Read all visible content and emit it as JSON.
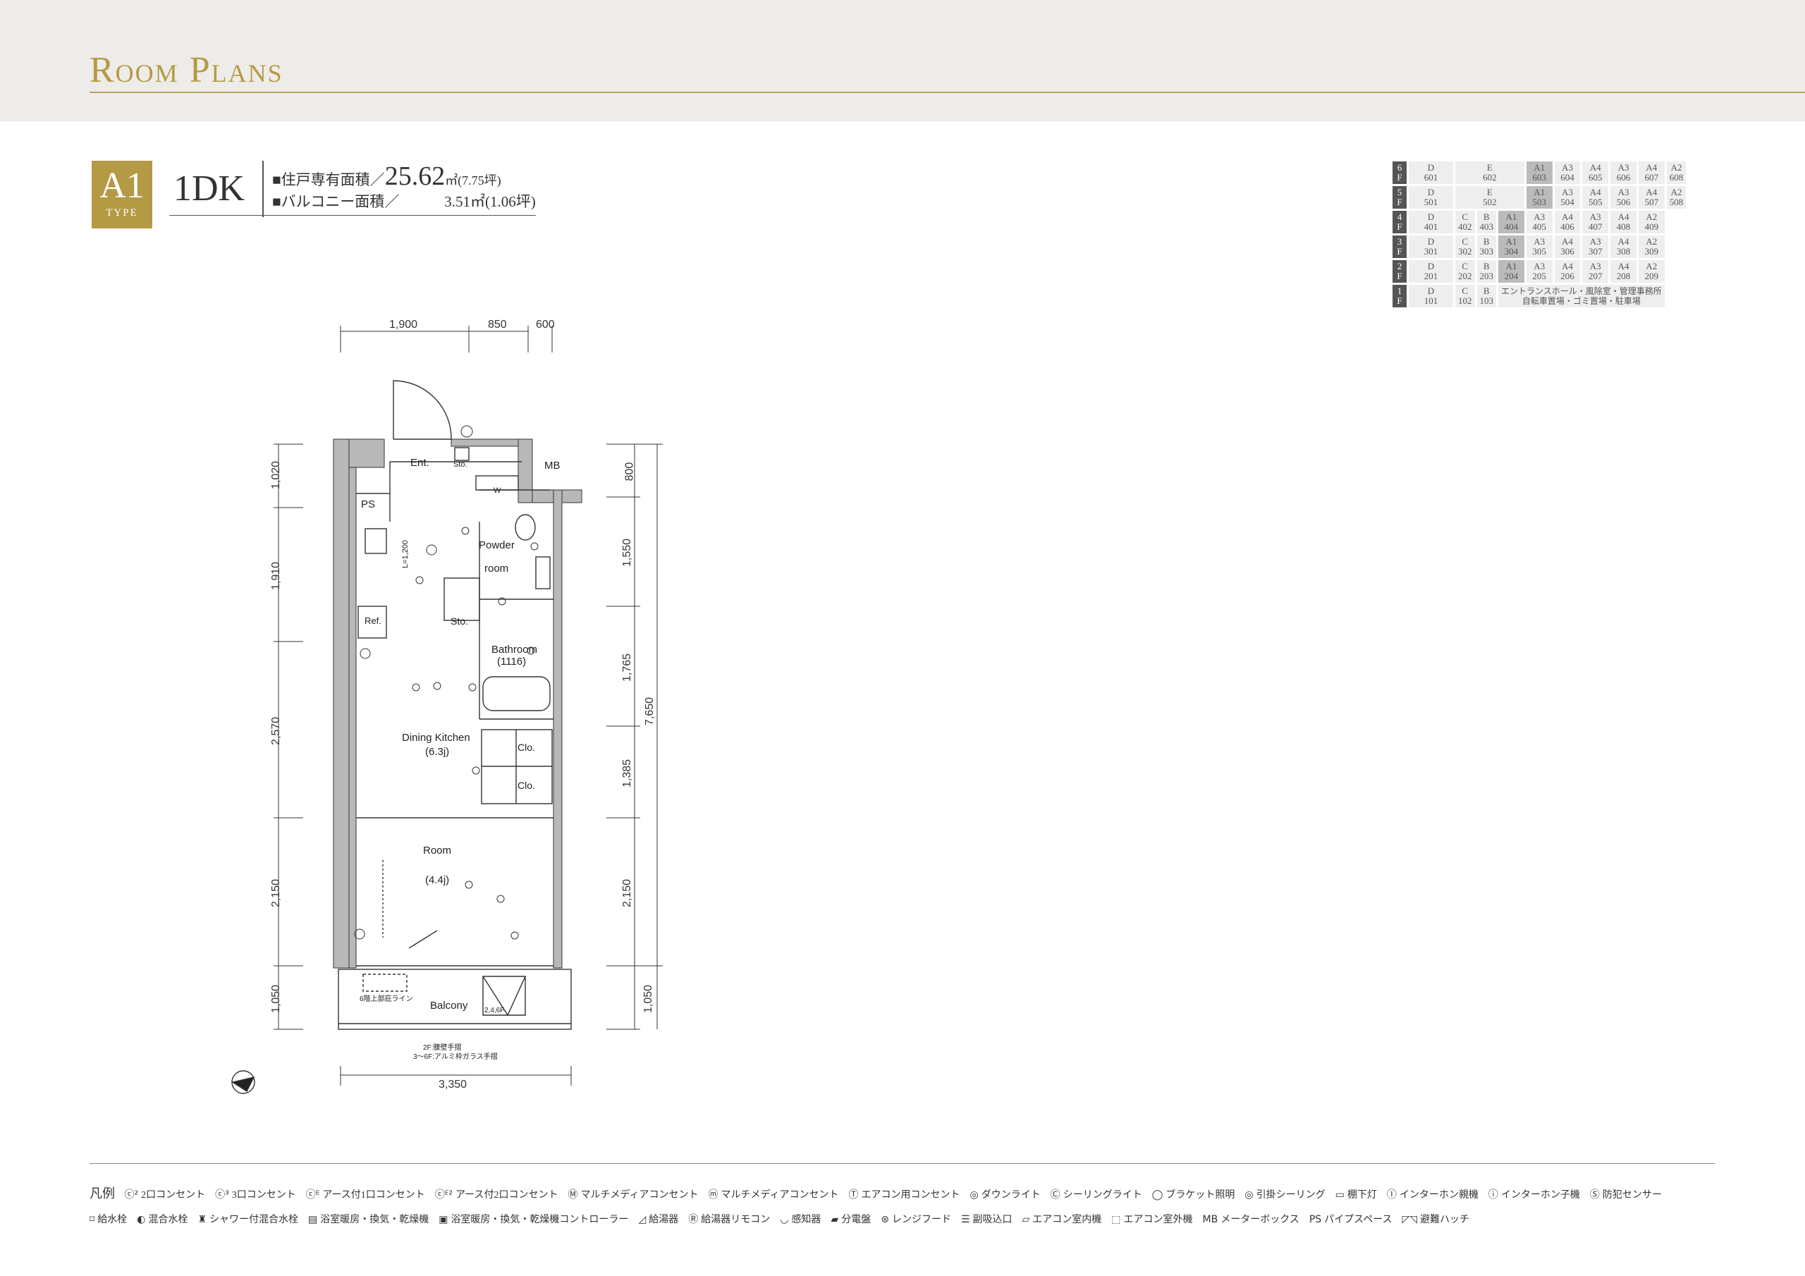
{
  "header": {
    "title": "Room Plans"
  },
  "type": {
    "code": "A1",
    "sub": "TYPE",
    "layout": "1DK"
  },
  "spec": {
    "private_label": "■住戸専有面積／",
    "private_value": "25.62",
    "private_unit": "㎡(7.75坪)",
    "balcony_label": "■バルコニー面積／",
    "balcony_value": "3.51㎡(1.06坪)"
  },
  "unit_table": {
    "rows": [
      {
        "floor": "6F",
        "cells": [
          [
            "D",
            "601"
          ],
          [
            "E",
            "602"
          ],
          [
            "A1",
            "603"
          ],
          [
            "A3",
            "604"
          ],
          [
            "A4",
            "605"
          ],
          [
            "A3",
            "606"
          ],
          [
            "A4",
            "607"
          ],
          [
            "A2",
            "608"
          ]
        ]
      },
      {
        "floor": "5F",
        "cells": [
          [
            "D",
            "501"
          ],
          [
            "E",
            "502"
          ],
          [
            "A1",
            "503"
          ],
          [
            "A3",
            "504"
          ],
          [
            "A4",
            "505"
          ],
          [
            "A3",
            "506"
          ],
          [
            "A4",
            "507"
          ],
          [
            "A2",
            "508"
          ]
        ]
      },
      {
        "floor": "4F",
        "cells": [
          [
            "D",
            "401"
          ],
          [
            "C",
            "402"
          ],
          [
            "B",
            "403"
          ],
          [
            "A1",
            "404"
          ],
          [
            "A3",
            "405"
          ],
          [
            "A4",
            "406"
          ],
          [
            "A3",
            "407"
          ],
          [
            "A4",
            "408"
          ],
          [
            "A2",
            "409"
          ]
        ]
      },
      {
        "floor": "3F",
        "cells": [
          [
            "D",
            "301"
          ],
          [
            "C",
            "302"
          ],
          [
            "B",
            "303"
          ],
          [
            "A1",
            "304"
          ],
          [
            "A3",
            "305"
          ],
          [
            "A4",
            "306"
          ],
          [
            "A3",
            "307"
          ],
          [
            "A4",
            "308"
          ],
          [
            "A2",
            "309"
          ]
        ]
      },
      {
        "floor": "2F",
        "cells": [
          [
            "D",
            "201"
          ],
          [
            "C",
            "202"
          ],
          [
            "B",
            "203"
          ],
          [
            "A1",
            "204"
          ],
          [
            "A3",
            "205"
          ],
          [
            "A4",
            "206"
          ],
          [
            "A3",
            "207"
          ],
          [
            "A4",
            "208"
          ],
          [
            "A2",
            "209"
          ]
        ]
      },
      {
        "floor": "1F",
        "cells": [
          [
            "D",
            "101"
          ],
          [
            "C",
            "102"
          ],
          [
            "B",
            "103"
          ]
        ],
        "note": [
          "エントランスホール・風除室・管理事務所",
          "自転車置場・ゴミ置場・駐車場"
        ]
      }
    ]
  },
  "plan": {
    "dims_top": [
      "1,900",
      "850",
      "600"
    ],
    "dims_left": [
      "1,020",
      "1,910",
      "2,570",
      "2,150",
      "1,050"
    ],
    "dims_right": [
      "800",
      "1,550",
      "1,765",
      "1,385",
      "2,150",
      "1,050"
    ],
    "dim_total": "7,650",
    "dim_bottom": "3,350",
    "rooms": {
      "ent": "Ent.",
      "sto_top": "Sto.",
      "mb": "MB",
      "ps": "PS",
      "powder": "Powder",
      "powder2": "room",
      "sto_mid": "Sto.",
      "bathroom": "Bathroom",
      "bathroom_size": "(1116)",
      "ref": "Ref.",
      "dk": "Dining Kitchen",
      "dk_size": "(6.3j)",
      "clo1": "Clo.",
      "clo2": "Clo.",
      "room": "Room",
      "room_size": "(4.4j)",
      "balcony": "Balcony",
      "hatch": "2,4,6F",
      "rail_note1": "2F:腰壁手摺",
      "rail_note2": "3〜6F:アルミ枠ガラス手摺",
      "ac_note": "6階上部庇ライン",
      "w": "W",
      "l_note": "L=1,200"
    }
  },
  "legend": {
    "head": "凡例",
    "items": [
      [
        "ⓒ²",
        "2口コンセント"
      ],
      [
        "ⓒ³",
        "3口コンセント"
      ],
      [
        "ⓒᴱ",
        "アース付1口コンセント"
      ],
      [
        "ⓒᴱ²",
        "アース付2口コンセント"
      ],
      [
        "Ⓜ",
        "マルチメディアコンセント"
      ],
      [
        "ⓜ",
        "マルチメディアコンセント"
      ],
      [
        "Ⓣ",
        "エアコン用コンセント"
      ],
      [
        "◎",
        "ダウンライト"
      ],
      [
        "Ⓒ",
        "シーリングライト"
      ],
      [
        "◯",
        "ブラケット照明"
      ],
      [
        "◎",
        "引掛シーリング"
      ],
      [
        "▭",
        "棚下灯"
      ],
      [
        "Ⓘ",
        "インターホン親機"
      ],
      [
        "ⓘ",
        "インターホン子機"
      ],
      [
        "Ⓢ",
        "防犯センサー"
      ],
      [
        "⌑",
        "給水栓"
      ],
      [
        "◐",
        "混合水栓"
      ],
      [
        "♜",
        "シャワー付混合水栓"
      ],
      [
        "▤",
        "浴室暖房・換気・乾燥機"
      ],
      [
        "▣",
        "浴室暖房・換気・乾燥機コントローラー"
      ],
      [
        "◿",
        "給湯器"
      ],
      [
        "Ⓡ",
        "給湯器リモコン"
      ],
      [
        "◡",
        "感知器"
      ],
      [
        "▰",
        "分電盤"
      ],
      [
        "⊛",
        "レンジフード"
      ],
      [
        "☰",
        "副吸込口"
      ],
      [
        "▱",
        "エアコン室内機"
      ],
      [
        "⬚",
        "エアコン室外機"
      ],
      [
        "MB",
        "メーターボックス"
      ],
      [
        "PS",
        "パイプスペース"
      ],
      [
        "◸◹",
        "避難ハッチ"
      ]
    ]
  }
}
